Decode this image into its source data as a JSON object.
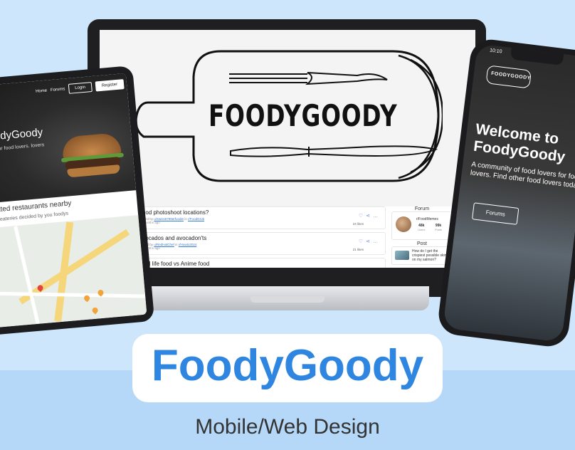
{
  "laptop": {
    "logo_text": "FOODYGOODY",
    "posts": [
      {
        "title": "Food photoshoot locations?",
        "meta_prefix": "Posted by ",
        "user": "u/Swiss6789erfoodie",
        "meta_in": " in ",
        "forum": "r/FoodGrub",
        "time": "10 months ago",
        "likes": "24 likes"
      },
      {
        "title": "Avocados and avocadon'ts",
        "meta_prefix": "Posted by ",
        "user": "u/RedHatChef",
        "meta_in": " in ",
        "forum": "r/Howto2024",
        "time": "10 months ago",
        "likes": "21 likes"
      },
      {
        "title": "Real life food vs Anime food",
        "meta_prefix": "",
        "user": "",
        "meta_in": "",
        "forum": "",
        "time": "",
        "likes": ""
      }
    ],
    "side": {
      "forum_heading": "Forum",
      "forum_name": "r/FoodMemes",
      "users_value": "48k",
      "users_label": "Users",
      "posts_value": "99k",
      "posts_label": "Posts",
      "post_heading": "Post",
      "post_text": "How do I get the crispiest possible skin on my salmon?"
    }
  },
  "tablet": {
    "nav": {
      "home": "Home",
      "forums": "Forums",
      "login": "Login",
      "register": "Register"
    },
    "hero_title": "to FoodyGoody",
    "hero_sub": "food lovers for food lovers. lovers today.",
    "section_title": "Top rated restaurants nearby",
    "section_sub": "Best eateries decided by you foodys"
  },
  "phone": {
    "time": "10:10",
    "logo_text": "FOODYGOODY",
    "title": "Welcome to FoodyGoody",
    "subtitle": "A community of food lovers for food lovers. Find other food lovers today.",
    "button": "Forums"
  },
  "caption": {
    "title": "FoodyGoody",
    "subtitle": "Mobile/Web Design"
  },
  "colors": {
    "accent": "#2f86e0",
    "background": "#cde6fb",
    "band": "#b6d8f8"
  }
}
